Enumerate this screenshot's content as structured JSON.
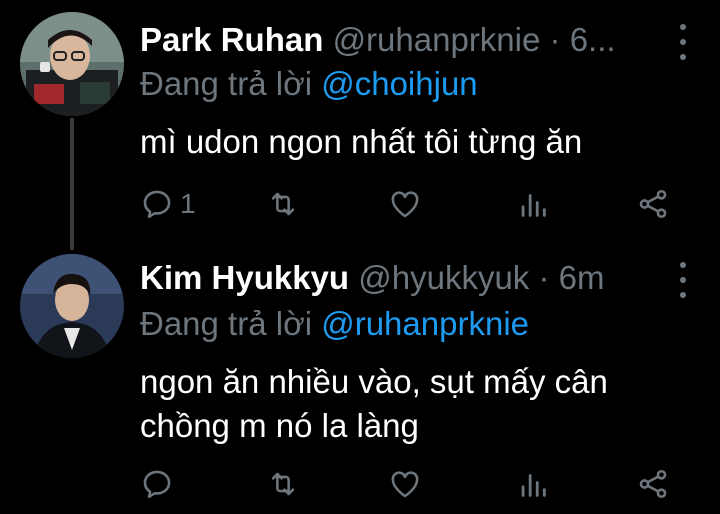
{
  "tweets": [
    {
      "name": "Park Ruhan",
      "handle": "@ruhanprknie",
      "separator": "·",
      "time": "6...",
      "reply_prefix": "Đang trả lời",
      "reply_to": "@choihjun",
      "text": "mì udon ngon nhất tôi từng ăn",
      "reply_count": "1",
      "icons": [
        "reply-icon",
        "retweet-icon",
        "like-icon",
        "stats-icon",
        "share-icon",
        "more-icon"
      ]
    },
    {
      "name": "Kim Hyukkyu",
      "handle": "@hyukkyuk",
      "separator": "·",
      "time": "6m",
      "reply_prefix": "Đang trả lời",
      "reply_to": "@ruhanprknie",
      "text_line1": "ngon ăn nhiều vào, sụt mấy cân",
      "text_line2": "chồng m nó la làng",
      "reply_count": "",
      "icons": [
        "reply-icon",
        "retweet-icon",
        "like-icon",
        "stats-icon",
        "share-icon",
        "more-icon"
      ]
    }
  ],
  "colors": {
    "background": "#000000",
    "text": "#ffffff",
    "secondary": "#6e767d",
    "mention": "#1d9bf0",
    "thread_line": "#3a3a3a"
  }
}
